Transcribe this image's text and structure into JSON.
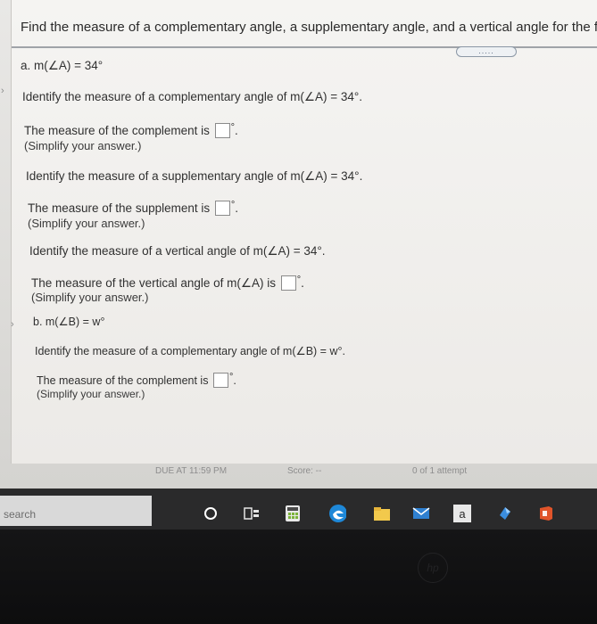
{
  "question": {
    "title": "Find the measure of a complementary angle, a supplementary angle, and a vertical angle for the followi",
    "more_label": "....."
  },
  "part_a": {
    "label": "a. m(∠A) = 34°",
    "complement_prompt": "Identify the measure of a complementary angle of m(∠A) = 34°.",
    "complement_answer_prefix": "The measure of the complement is",
    "supplement_prompt": "Identify the measure of a supplementary angle of m(∠A) = 34°.",
    "supplement_answer_prefix": "The measure of the supplement is",
    "vertical_prompt": "Identify the measure of a vertical angle of m(∠A) = 34°.",
    "vertical_answer_prefix": "The measure of the vertical angle of m(∠A) is",
    "simplify": "(Simplify your answer.)"
  },
  "part_b": {
    "label": "b. m(∠B) = w°",
    "complement_prompt": "Identify the measure of a complementary angle of m(∠B) = w°.",
    "complement_answer_prefix": "The measure of the complement is",
    "simplify": "(Simplify your answer.)"
  },
  "degree_symbol": "°",
  "period": ".",
  "status": {
    "due": "DUE AT 11:59 PM",
    "score": "Score: --",
    "attempt": "0 of 1 attempt"
  },
  "taskbar": {
    "search_placeholder": "search",
    "store_letter": "a"
  },
  "laptop_logo": "hp",
  "colors": {
    "accent_blue": "#3f74c9",
    "taskbar": "#2a2a2b",
    "edge_blue": "#1e88d8",
    "store_orange": "#e0542a"
  }
}
